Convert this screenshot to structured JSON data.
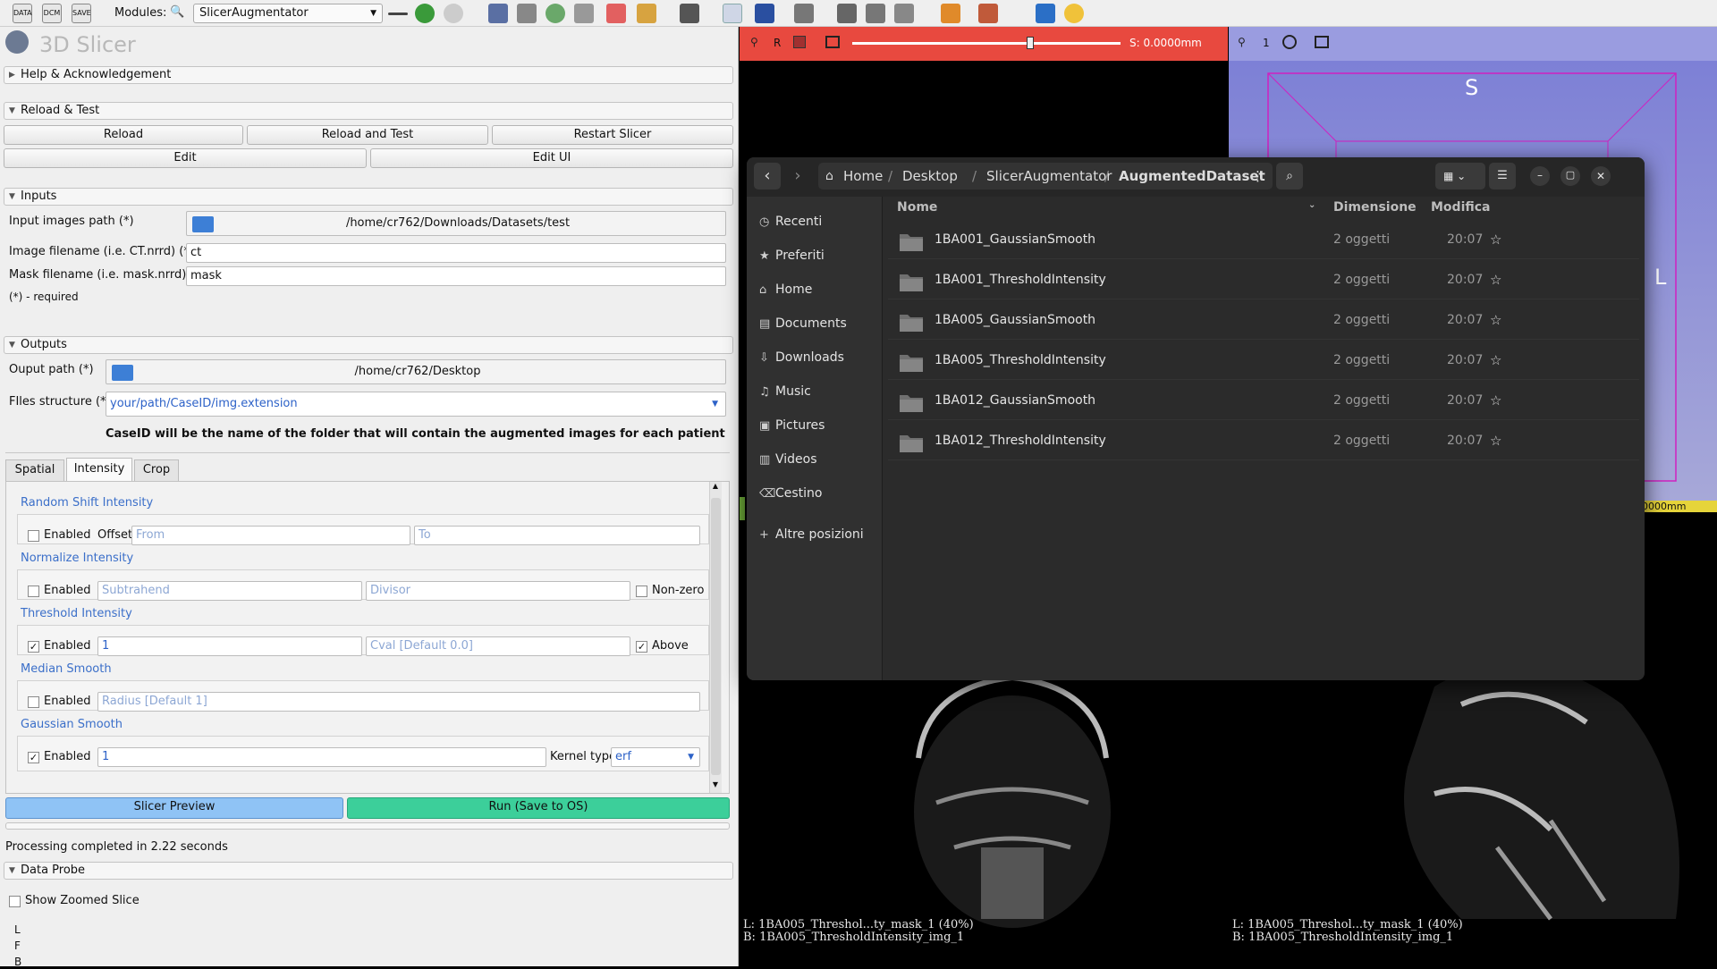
{
  "toolbar": {
    "modules_label": "Modules:",
    "module_selected": "SlicerAugmentator"
  },
  "app": {
    "title": "3D Slicer"
  },
  "sections": {
    "help": "Help & Acknowledgement",
    "reload": "Reload & Test",
    "inputs": "Inputs",
    "outputs": "Outputs",
    "probe": "Data Probe"
  },
  "reload": {
    "reload": "Reload",
    "reload_test": "Reload and Test",
    "restart": "Restart Slicer",
    "edit": "Edit",
    "edit_ui": "Edit UI"
  },
  "inputs": {
    "images_path_label": "Input images path (*)",
    "images_path": "/home/cr762/Downloads/Datasets/test",
    "image_fn_label": "Image filename (i.e. CT.nrrd) (*)",
    "image_fn": "ct",
    "mask_fn_label": "Mask filename (i.e. mask.nrrd)",
    "mask_fn": "mask",
    "required": "(*) - required"
  },
  "outputs": {
    "path_label": "Ouput path (*)",
    "path": "/home/cr762/Desktop",
    "structure_label": "FIles structure (*)",
    "structure": "your/path/CaseID/img.extension",
    "note": "CaseID will be the name of the folder that will contain the augmented images for each patient"
  },
  "tabs": [
    "Spatial",
    "Intensity",
    "Crop"
  ],
  "intensity": {
    "rsi_title": "Random Shift Intensity",
    "enabled": "Enabled",
    "offset": "Offset",
    "from_ph": "From",
    "to_ph": "To",
    "ni_title": "Normalize Intensity",
    "subtrahend_ph": "Subtrahend",
    "divisor_ph": "Divisor",
    "nonzero": "Non-zero",
    "ti_title": "Threshold Intensity",
    "ti_value": "1",
    "cval_ph": "Cval [Default 0.0]",
    "above": "Above",
    "ms_title": "Median Smooth",
    "radius_ph": "Radius [Default 1]",
    "gs_title": "Gaussian Smooth",
    "gs_value": "1",
    "kernel_label": "Kernel type",
    "kernel": "erf"
  },
  "actions": {
    "preview": "Slicer Preview",
    "run": "Run (Save to OS)",
    "status": "Processing completed in 2.22 seconds"
  },
  "probe": {
    "show_zoomed": "Show Zoomed Slice",
    "l": "L",
    "f": "F",
    "b": "B"
  },
  "slice_red": {
    "orient": "R",
    "offset": "S: 0.0000mm",
    "overlay_l": "L: 1BA005_Threshol...ty_mask_1 (40%)",
    "overlay_b": "B: 1BA005_ThresholdIntensity_img_1"
  },
  "view_blue": {
    "num": "1",
    "s_label": "S",
    "l_label": "L",
    "partial_mm": "0000mm",
    "overlay_l": "L: 1BA005_Threshol...ty_mask_1 (40%)",
    "overlay_b": "B: 1BA005_ThresholdIntensity_img_1"
  },
  "files": {
    "breadcrumb": [
      "Home",
      "Desktop",
      "SlicerAugmentator",
      "AugmentedDataset"
    ],
    "sidebar": [
      "Recenti",
      "Preferiti",
      "Home",
      "Documents",
      "Downloads",
      "Music",
      "Pictures",
      "Videos",
      "Cestino",
      "Altre posizioni"
    ],
    "columns": {
      "name": "Nome",
      "size": "Dimensione",
      "modified": "Modifica"
    },
    "rows": [
      {
        "name": "1BA001_GaussianSmooth",
        "size": "2 oggetti",
        "time": "20:07"
      },
      {
        "name": "1BA001_ThresholdIntensity",
        "size": "2 oggetti",
        "time": "20:07"
      },
      {
        "name": "1BA005_GaussianSmooth",
        "size": "2 oggetti",
        "time": "20:07"
      },
      {
        "name": "1BA005_ThresholdIntensity",
        "size": "2 oggetti",
        "time": "20:07"
      },
      {
        "name": "1BA012_GaussianSmooth",
        "size": "2 oggetti",
        "time": "20:07"
      },
      {
        "name": "1BA012_ThresholdIntensity",
        "size": "2 oggetti",
        "time": "20:07"
      }
    ]
  },
  "colors": {
    "slicer_red": "#e8493f",
    "slicer_blue": "#9a9ce0",
    "run_green": "#3ccf9a",
    "preview_blue": "#8fc3f5"
  }
}
